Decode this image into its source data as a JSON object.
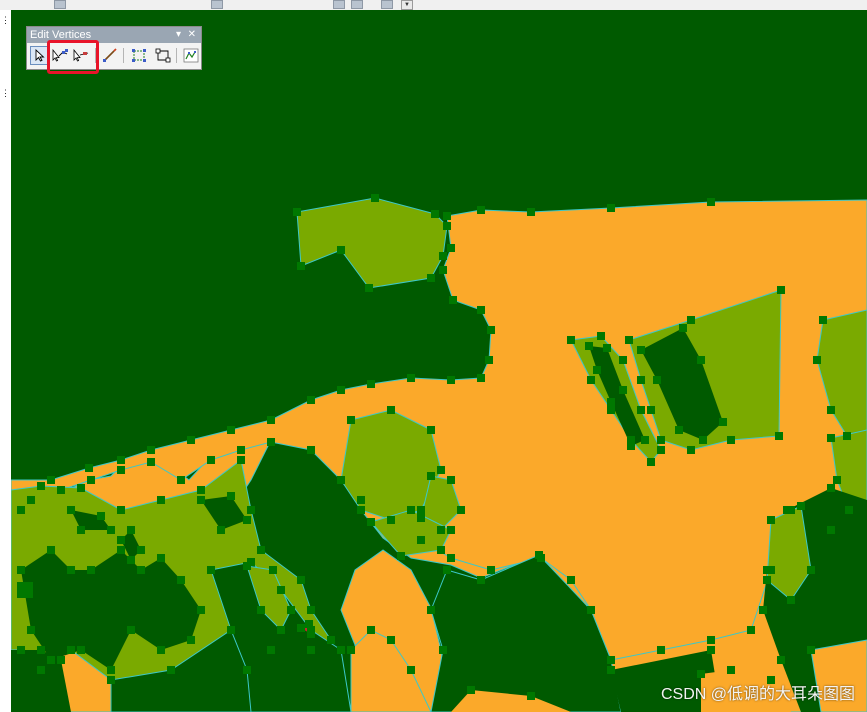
{
  "editor_toolbar": {
    "title": "Edit Vertices",
    "menu_glyph": "▾",
    "close_glyph": "✕",
    "tools": [
      {
        "icon": "select-arrow-icon",
        "active": true
      },
      {
        "icon": "add-vertex-icon"
      },
      {
        "icon": "delete-vertex-icon"
      },
      {
        "icon": "sketch-properties-icon"
      },
      {
        "icon": "continue-feature-icon"
      },
      {
        "icon": "reshape-feature-icon"
      },
      {
        "icon": "finish-sketch-icon"
      }
    ],
    "highlight_color": "#e8142a"
  },
  "map": {
    "colors": {
      "forest": "#005a00",
      "grass": "#7aaa00",
      "urban": "#fba92a",
      "edge": "#3cc8c8",
      "vertex": "#007800"
    }
  },
  "watermark": "CSDN @低调的大耳朵图图"
}
